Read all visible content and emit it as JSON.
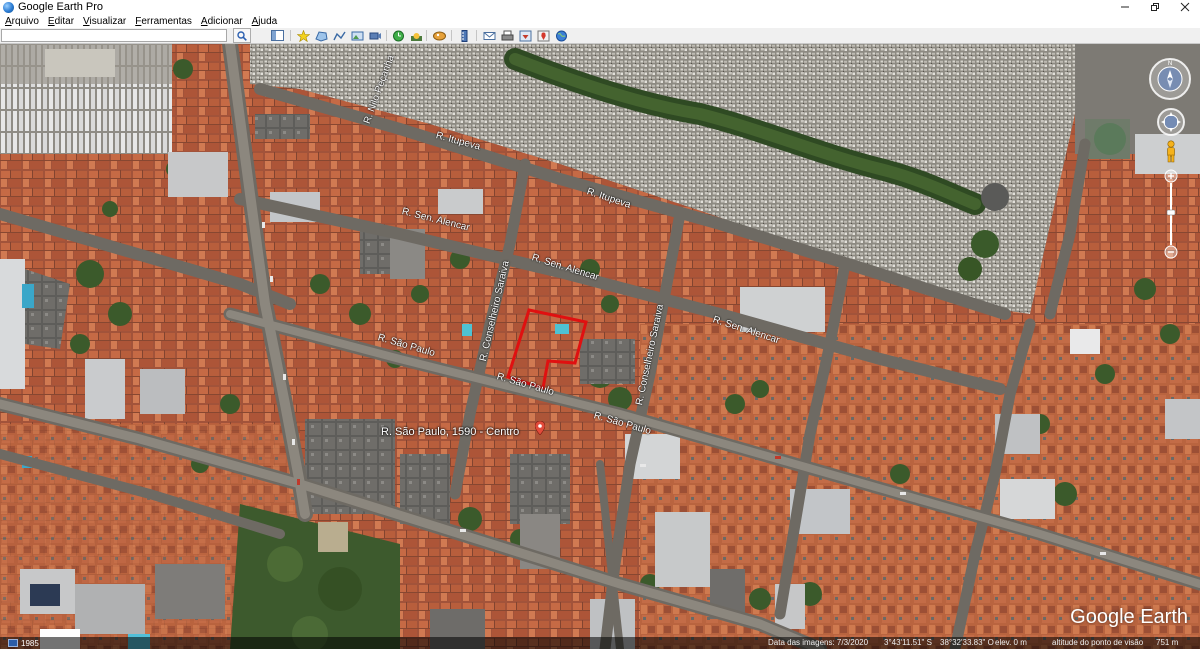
{
  "window": {
    "title": "Google Earth Pro",
    "controls": {
      "minimize": "–",
      "maximize": "❐",
      "close": "✕"
    }
  },
  "menu": {
    "items": [
      "Arquivo",
      "Editar",
      "Visualizar",
      "Ferramentas",
      "Adicionar",
      "Ajuda"
    ]
  },
  "toolbar": {
    "search_value": "",
    "search_icon": "magnifier-icon",
    "buttons": [
      "sidebar-toggle-icon",
      "placemark-icon",
      "polygon-icon",
      "path-icon",
      "image-overlay-icon",
      "record-tour-icon",
      "historical-imagery-icon",
      "sunlight-icon",
      "switch-to-sky-icon",
      "ruler-icon",
      "email-icon",
      "print-icon",
      "save-image-icon",
      "view-in-maps-icon",
      "earth-gallery-icon"
    ]
  },
  "map": {
    "streets": [
      "R. Nilo Peçanha",
      "R. Itupeva",
      "R. Itupeva",
      "R. Sen. Alencar",
      "R. Sen. Alencar",
      "R. Sen. Alencar",
      "R. Conselheiro Saraiva",
      "R. Conselheiro Saraiva",
      "R. São Paulo",
      "R. São Paulo",
      "R. São Paulo"
    ],
    "place_label": "R. São Paulo, 1590 - Centro",
    "logo": "Google Earth",
    "highlight_color": "#e01010"
  },
  "status": {
    "tour_year": "1985",
    "imagery_date": "Data das imagens: 7/3/2020",
    "latitude": "3°43'11.51\" S",
    "longitude": "38°32'33.83\" O",
    "elevation": "elev.   0 m",
    "eye_altitude": "altitude do ponto de visão",
    "eye_altitude_value": "751 m"
  }
}
